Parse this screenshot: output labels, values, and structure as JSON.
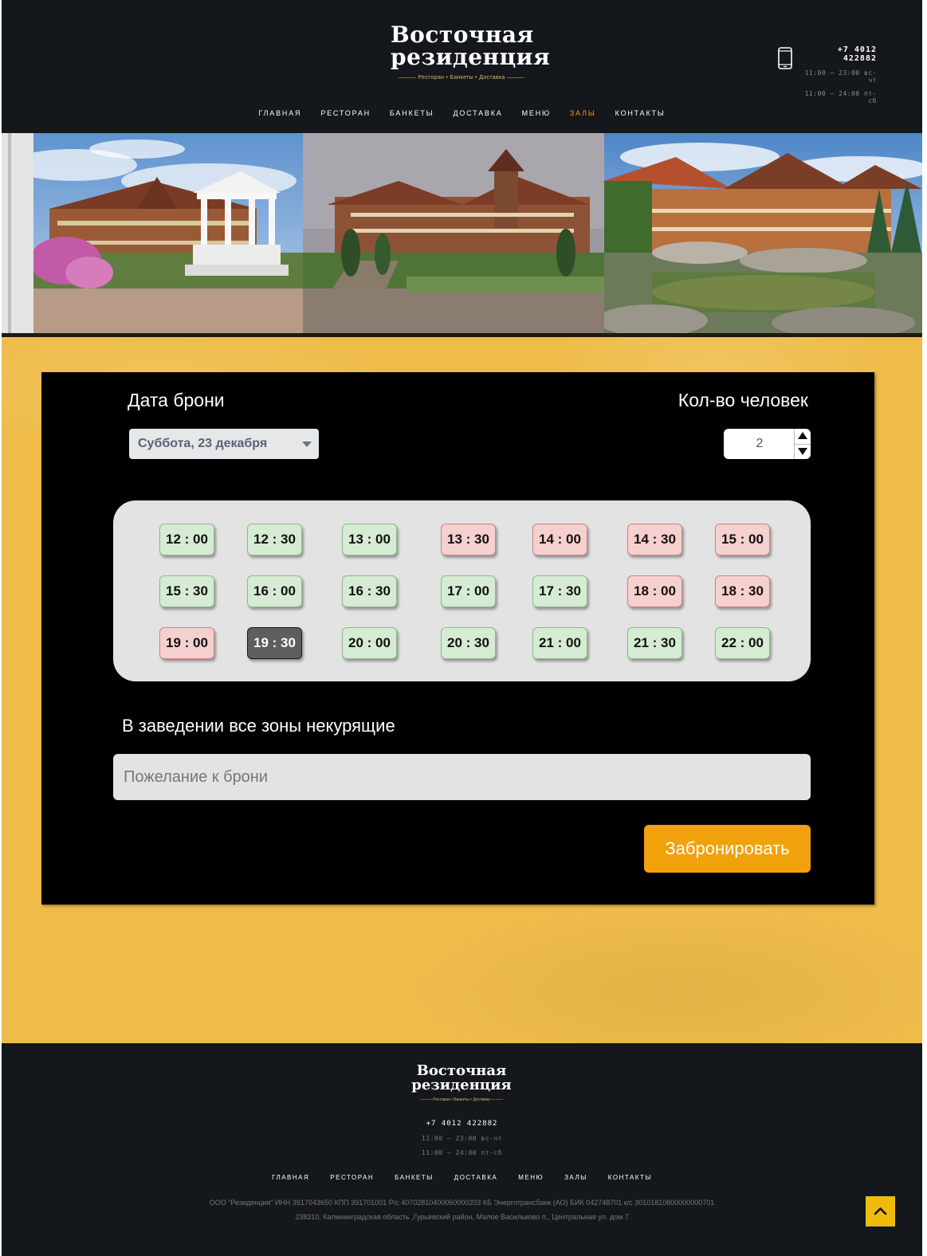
{
  "header": {
    "logo": {
      "line1": "Восточная",
      "line2": "резиденция",
      "tagline": "——— Ресторан • Банкеты • Доставка ———"
    },
    "phone": "+7 4012 422882",
    "hours": [
      "11:00 – 23:00 вс-чт",
      "11:00 – 24:00 пт-сб"
    ],
    "phone_icon": "mobile-phone-icon"
  },
  "nav": {
    "items": [
      {
        "label": "ГЛАВНАЯ",
        "active": false
      },
      {
        "label": "РЕСТОРАН",
        "active": false
      },
      {
        "label": "БАНКЕТЫ",
        "active": false
      },
      {
        "label": "ДОСТАВКА",
        "active": false
      },
      {
        "label": "МЕНЮ",
        "active": false
      },
      {
        "label": "ЗАЛЫ",
        "active": true
      },
      {
        "label": "КОНТАКТЫ",
        "active": false
      }
    ]
  },
  "booking": {
    "date_label": "Дата брони",
    "date_value": "Суббота, 23 декабря",
    "guests_label": "Кол-во человек",
    "guests_value": "2",
    "slots": [
      [
        {
          "time": "12 : 00",
          "status": "free"
        },
        {
          "time": "12 : 30",
          "status": "free"
        },
        {
          "time": "13 : 00",
          "status": "free"
        },
        {
          "time": "13 : 30",
          "status": "busy"
        },
        {
          "time": "14 : 00",
          "status": "busy"
        },
        {
          "time": "14 : 30",
          "status": "busy"
        },
        {
          "time": "15 : 00",
          "status": "busy"
        }
      ],
      [
        {
          "time": "15 : 30",
          "status": "free"
        },
        {
          "time": "16 : 00",
          "status": "free"
        },
        {
          "time": "16 : 30",
          "status": "free"
        },
        {
          "time": "17 : 00",
          "status": "free"
        },
        {
          "time": "17 : 30",
          "status": "free"
        },
        {
          "time": "18 : 00",
          "status": "busy"
        },
        {
          "time": "18 : 30",
          "status": "busy"
        }
      ],
      [
        {
          "time": "19 : 00",
          "status": "busy"
        },
        {
          "time": "19 : 30",
          "status": "selected"
        },
        {
          "time": "20 : 00",
          "status": "free"
        },
        {
          "time": "20 : 30",
          "status": "free"
        },
        {
          "time": "21 : 00",
          "status": "free"
        },
        {
          "time": "21 : 30",
          "status": "free"
        },
        {
          "time": "22 : 00",
          "status": "free"
        }
      ]
    ],
    "no_smoking_note": "В заведении все зоны некурящие",
    "wish_placeholder": "Пожелание к брони",
    "submit_label": "Забронировать"
  },
  "footer": {
    "logo": {
      "line1": "Восточная",
      "line2": "резиденция",
      "tagline": "——— Ресторан • Банкеты • Доставка ———"
    },
    "phone": "+7 4012 422882",
    "hours": [
      "11:00 – 23:00 вс-чт",
      "11:00 – 24:00 пт-сб"
    ],
    "nav": [
      "ГЛАВНАЯ",
      "РЕСТОРАН",
      "БАНКЕТЫ",
      "ДОСТАВКА",
      "МЕНЮ",
      "ЗАЛЫ",
      "КОНТАКТЫ"
    ],
    "legal_line1": "ООО \"Резиденция\" ИНН 3917043650 КПП 391701001 Р/с 40702810400050000203 КБ Энерготрансбанк (АО) БИК 042748701 к/с 30101810800000000701",
    "legal_line2": "238310, Калининградская область ,Гурьевский район, Малое Васильково п., Центральная ул. дом 7",
    "to_top_icon": "chevron-up-icon"
  },
  "colors": {
    "header_bg": "#14171b",
    "accent": "#f0a10c",
    "page_bg": "#efbc4a",
    "slot_free": "#d6ebd3",
    "slot_busy": "#f6cfcf",
    "slot_selected": "#5e5e5e"
  }
}
